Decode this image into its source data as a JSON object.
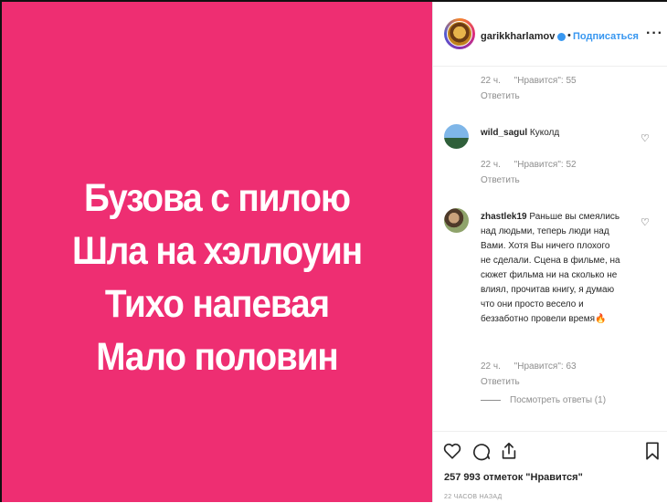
{
  "post": {
    "caption_lines": [
      "Бузова с пилою",
      "Шла на хэллоуин",
      "Тихо напевая",
      "Мало половин"
    ],
    "background_color": "#ee2e72"
  },
  "header": {
    "username": "garikkharlamov",
    "separator": "•",
    "follow_label": "Подписаться",
    "more_label": "···"
  },
  "comments": [
    {
      "time": "22 ч.",
      "likes": "\"Нравится\": 55",
      "reply_label": "Ответить"
    },
    {
      "username": "wild_sagul",
      "text": "Куколд",
      "time": "22 ч.",
      "likes": "\"Нравится\": 52",
      "reply_label": "Ответить"
    },
    {
      "username": "zhastlek19",
      "text_lines": [
        "Раньше вы смеялись",
        "над людьми, теперь люди над",
        "Вами. Хотя Вы ничего плохого",
        "не сделали. Сцена в фильме, на",
        "сюжет фильма ни на сколько не",
        "влиял, прочитав книгу, я думаю",
        "что они просто весело и",
        "беззаботно провели время🔥"
      ],
      "time": "22 ч.",
      "likes": "\"Нравится\": 63",
      "reply_label": "Ответить",
      "view_replies": "Посмотреть ответы (1)"
    }
  ],
  "footer": {
    "likes_count": "257 993",
    "likes_label": "отметок \"Нравится\"",
    "date": "22 ЧАСОВ НАЗАД"
  },
  "icons": [
    "heart-icon",
    "comment-icon",
    "share-icon",
    "bookmark-icon",
    "verified-icon",
    "more-icon"
  ]
}
